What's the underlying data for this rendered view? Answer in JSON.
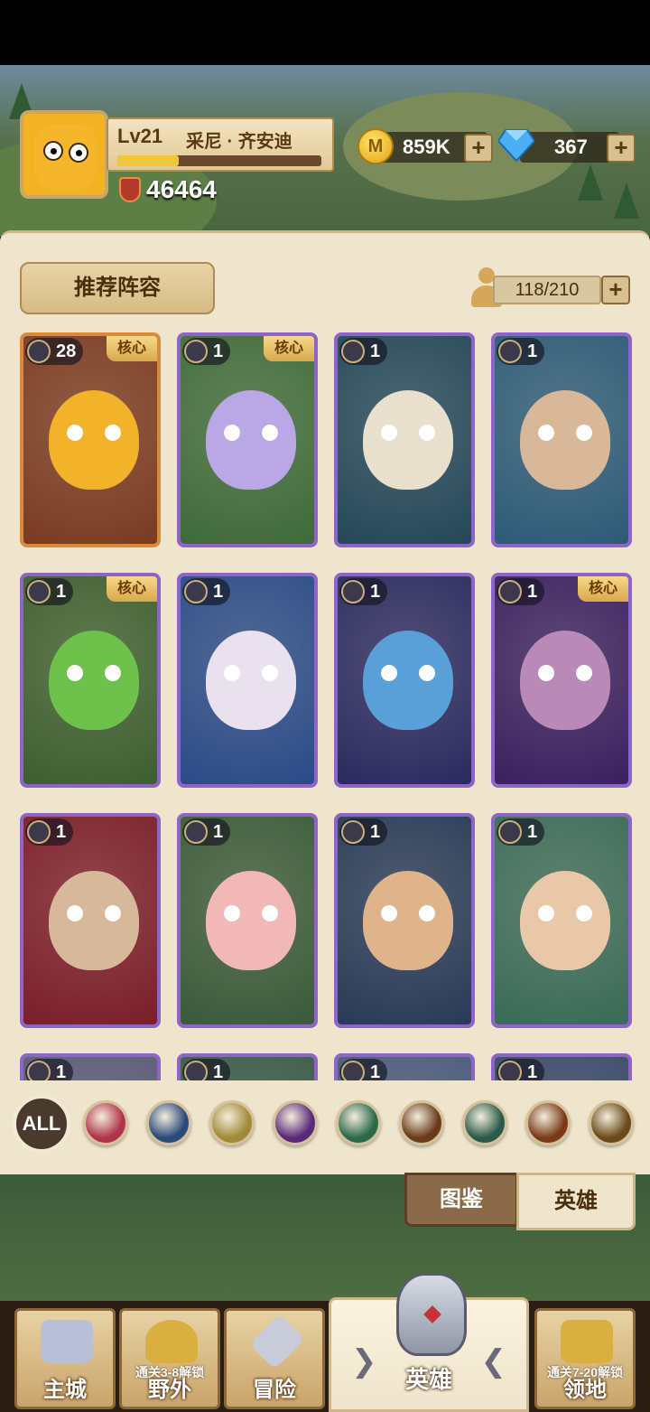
{
  "player": {
    "level": "Lv21",
    "name": "采尼 · 齐安迪",
    "xp_fraction": 0.3,
    "power": "46464"
  },
  "resources": {
    "coins": "859K",
    "coin_symbol": "M",
    "gems": "367"
  },
  "panel": {
    "recommend_label": "推荐阵容",
    "capacity": "118/210"
  },
  "heroes": [
    {
      "count": "28",
      "core": "核心",
      "frame": "gold",
      "bg": "#7a3a22",
      "skin": "#f2b22a"
    },
    {
      "count": "1",
      "core": "核心",
      "frame": "purple",
      "bg": "#3e6a3a",
      "skin": "#b9a7e6"
    },
    {
      "count": "1",
      "core": "",
      "frame": "purple",
      "bg": "#24475a",
      "skin": "#e8e0cc"
    },
    {
      "count": "1",
      "core": "",
      "frame": "purple",
      "bg": "#2c5a78",
      "skin": "#d8b898"
    },
    {
      "count": "1",
      "core": "核心",
      "frame": "purple",
      "bg": "#3d5e30",
      "skin": "#6ec14a"
    },
    {
      "count": "1",
      "core": "",
      "frame": "purple",
      "bg": "#2a4a88",
      "skin": "#e9e2ee"
    },
    {
      "count": "1",
      "core": "",
      "frame": "purple",
      "bg": "#2a2a60",
      "skin": "#5aa0d8"
    },
    {
      "count": "1",
      "core": "核心",
      "frame": "purple",
      "bg": "#3a2060",
      "skin": "#b98ab8"
    },
    {
      "count": "1",
      "core": "",
      "frame": "purple",
      "bg": "#7a1e2a",
      "skin": "#d8b89a"
    },
    {
      "count": "1",
      "core": "",
      "frame": "purple",
      "bg": "#3a5a3a",
      "skin": "#f2b8b8"
    },
    {
      "count": "1",
      "core": "",
      "frame": "purple",
      "bg": "#283a58",
      "skin": "#e0b48a"
    },
    {
      "count": "1",
      "core": "",
      "frame": "purple",
      "bg": "#3a6a58",
      "skin": "#e8c8a8"
    },
    {
      "count": "1",
      "core": "",
      "frame": "purple",
      "bg": "#5a5a78",
      "skin": "#c8c8d8"
    },
    {
      "count": "1",
      "core": "",
      "frame": "purple",
      "bg": "#3a5a4a",
      "skin": "#c8c8d8"
    },
    {
      "count": "1",
      "core": "",
      "frame": "purple",
      "bg": "#4a5a7a",
      "skin": "#c8c8d8"
    },
    {
      "count": "1",
      "core": "",
      "frame": "purple",
      "bg": "#3a4a6a",
      "skin": "#c8c8d8"
    }
  ],
  "filters": {
    "all_label": "ALL",
    "icons": [
      {
        "name": "shield-icon",
        "color": "#b0334a"
      },
      {
        "name": "staff-icon",
        "color": "#2a4a7a"
      },
      {
        "name": "emblem-icon",
        "color": "#a08a3a"
      },
      {
        "name": "skull-icon",
        "color": "#5a2a7a"
      },
      {
        "name": "crossed-swords-icon",
        "color": "#2a6a4a"
      },
      {
        "name": "paw-icon",
        "color": "#6a3a1a"
      },
      {
        "name": "bow-icon",
        "color": "#2a5a4a"
      },
      {
        "name": "bull-icon",
        "color": "#7a3a1a"
      },
      {
        "name": "hammer-icon",
        "color": "#6a4a1a"
      }
    ]
  },
  "side_tabs": {
    "book": "图鉴",
    "hero": "英雄"
  },
  "nav": {
    "city": "主城",
    "wild": "野外",
    "wild_lock": "通关3-8解锁",
    "adventure": "冒险",
    "heroes": "英雄",
    "territory": "领地",
    "territory_lock": "通关7-20解锁"
  }
}
